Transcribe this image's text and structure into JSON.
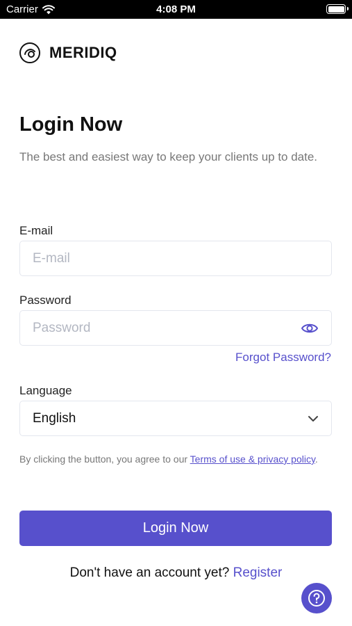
{
  "status_bar": {
    "carrier": "Carrier",
    "time": "4:08 PM"
  },
  "brand": {
    "name": "MERIDIQ"
  },
  "page": {
    "title": "Login Now",
    "subtitle": "The best and easiest way to keep your clients up to date."
  },
  "email": {
    "label": "E-mail",
    "placeholder": "E-mail"
  },
  "password": {
    "label": "Password",
    "placeholder": "Password",
    "forgot": "Forgot Password?"
  },
  "language": {
    "label": "Language",
    "selected": "English"
  },
  "terms": {
    "prefix": "By clicking the button, you agree to our ",
    "link": "Terms of use & privacy policy",
    "suffix": "."
  },
  "login_button": "Login Now",
  "signup": {
    "prompt": "Don't have an account yet? ",
    "link": "Register"
  },
  "colors": {
    "accent": "#5750cc",
    "placeholder": "#b3b7c2",
    "muted_text": "#777777"
  },
  "icons": [
    "wifi-icon",
    "battery-icon",
    "meridiq-logo-icon",
    "eye-icon",
    "chevron-down-icon",
    "help-icon"
  ]
}
